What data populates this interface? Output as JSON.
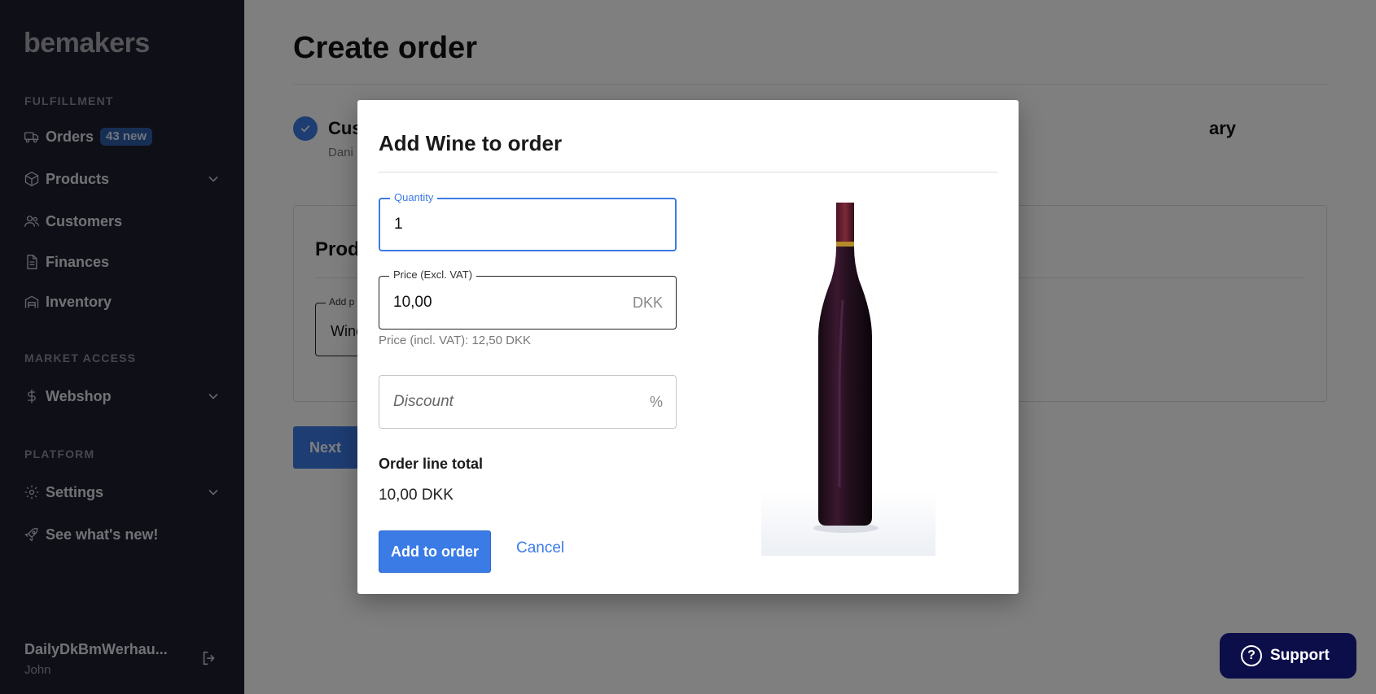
{
  "app": {
    "logo": "bemakers"
  },
  "sidebar": {
    "sections": {
      "fulfillment": "FULFILLMENT",
      "market_access": "MARKET ACCESS",
      "platform": "PLATFORM"
    },
    "items": {
      "orders": {
        "label": "Orders",
        "badge": "43 new",
        "icon": "truck-icon"
      },
      "products": {
        "label": "Products",
        "icon": "box-icon"
      },
      "customers": {
        "label": "Customers",
        "icon": "users-icon"
      },
      "finances": {
        "label": "Finances",
        "icon": "document-icon"
      },
      "inventory": {
        "label": "Inventory",
        "icon": "warehouse-icon"
      },
      "webshop": {
        "label": "Webshop",
        "icon": "dollar-icon"
      },
      "settings": {
        "label": "Settings",
        "icon": "gear-icon"
      },
      "whats_new": {
        "label": "See what's new!",
        "icon": "rocket-icon"
      }
    },
    "user": {
      "name": "DailyDkBmWerhau...",
      "sub": "John"
    }
  },
  "page": {
    "title": "Create order",
    "step1": {
      "label": "Cus",
      "sub": "Dani"
    },
    "step_right": {
      "label": "ary"
    },
    "card": {
      "title": "Prod",
      "field_label": "Add p",
      "field_value": "Wine"
    },
    "next_label": "Next"
  },
  "modal": {
    "title": "Add Wine to order",
    "quantity": {
      "label": "Quantity",
      "value": "1"
    },
    "price": {
      "label": "Price (Excl. VAT)",
      "value": "10,00",
      "suffix": "DKK"
    },
    "price_helper": "Price (incl. VAT): 12,50 DKK",
    "discount": {
      "placeholder": "Discount",
      "suffix": "%"
    },
    "order_line_total_label": "Order line total",
    "order_line_total_value": "10,00 DKK",
    "add_button": "Add to order",
    "cancel_button": "Cancel"
  },
  "support": {
    "label": "Support"
  }
}
